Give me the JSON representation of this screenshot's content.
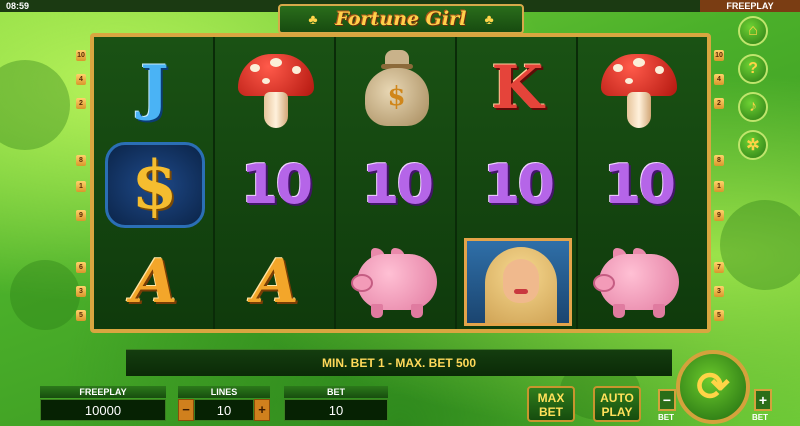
{
  "status": {
    "time": "08:59",
    "mode": "FREEPLAY"
  },
  "logo": {
    "title": "Fortune Girl"
  },
  "reels": [
    [
      "J",
      "mushroom",
      "A"
    ],
    [
      "$",
      "10",
      "A"
    ],
    [
      "mushroom",
      "10",
      "piggy-bank"
    ],
    [
      "money-bag",
      "10",
      "girl"
    ],
    [
      "K",
      "10",
      "piggy-bank"
    ],
    [
      "mushroom",
      "10",
      "piggy-bank"
    ]
  ],
  "symbols": {
    "card_j": "J",
    "card_k": "K",
    "card_a": "A",
    "ten": "10",
    "dollar": "$",
    "bag_dollar": "$"
  },
  "paylines_left": [
    "10",
    "4",
    "2",
    "8",
    "1",
    "9",
    "6",
    "3",
    "5"
  ],
  "paylines_right": [
    "10",
    "4",
    "2",
    "8",
    "1",
    "9",
    "7",
    "3",
    "5"
  ],
  "side_icons": [
    "home-icon",
    "help-icon",
    "sound-icon",
    "settings-icon"
  ],
  "message": "MIN. BET 1 - MAX. BET 500",
  "bottom": {
    "freeplay_label": "FREEPLAY",
    "freeplay_value": "10000",
    "lines_label": "LINES",
    "lines_value": "10",
    "bet_label": "BET",
    "bet_value": "10",
    "minus": "−",
    "plus": "+"
  },
  "buttons": {
    "max_bet_line1": "MAX",
    "max_bet_line2": "BET",
    "auto_play_line1": "AUTO",
    "auto_play_line2": "PLAY",
    "bet_minus": "−",
    "bet_minus_label": "BET",
    "bet_plus": "+",
    "bet_plus_label": "BET",
    "spin_glyph": "⟳"
  }
}
